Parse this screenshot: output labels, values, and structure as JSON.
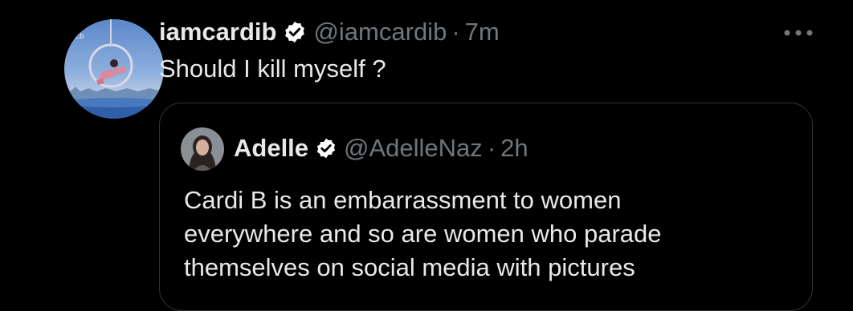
{
  "tweet": {
    "display_name": "iamcardib",
    "handle": "@iamcardib",
    "separator": "·",
    "time": "7m",
    "text": "Should I kill myself ?",
    "avatar_icon": "album-cover-avatar",
    "verified_icon": "verified-badge-icon",
    "more_icon": "more-options-icon"
  },
  "quote": {
    "display_name": "Adelle",
    "handle": "@AdelleNaz",
    "separator": "·",
    "time": "2h",
    "text_lines": [
      "Cardi B is an embarrassment to women",
      "everywhere and so are women who parade",
      "themselves on social media with pictures"
    ]
  },
  "colors": {
    "background": "#000000",
    "primary_text": "#e7e9ea",
    "secondary_text": "#71767b",
    "border": "#2f3336",
    "verified_badge": "#ffffff"
  }
}
